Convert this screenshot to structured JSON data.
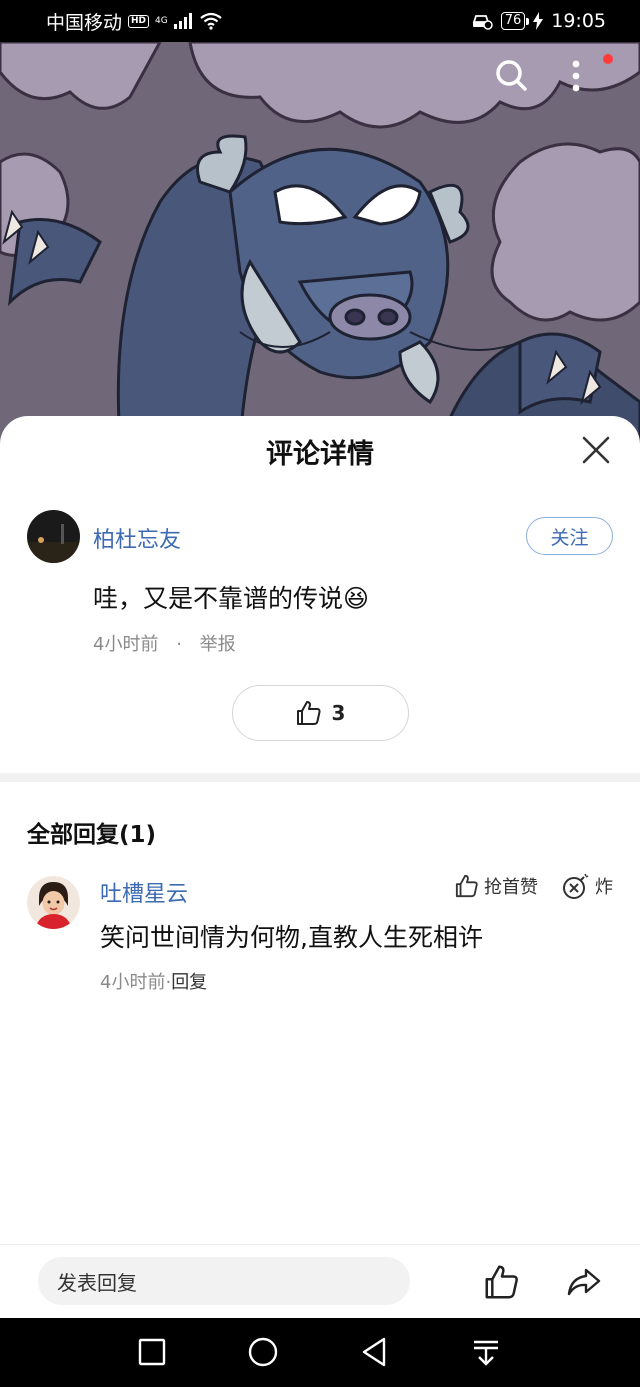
{
  "status_bar": {
    "carrier": "中国移动",
    "hd_badge": "HD",
    "network": "4G",
    "battery": "76",
    "time": "19:05"
  },
  "hero": {
    "icons": [
      "search-icon",
      "more-vertical-icon"
    ],
    "notification_dot_color": "#ff3b3b"
  },
  "sheet": {
    "title": "评论详情",
    "comment": {
      "author": "柏杜忘友",
      "follow_label": "关注",
      "text": "哇，又是不靠谱的传说😆",
      "time": "4小时前",
      "separator": "·",
      "report_label": "举报",
      "like_count": "3"
    },
    "replies_header": "全部回复(1)",
    "replies": [
      {
        "author": "吐槽星云",
        "text": "笑问世间情为何物,直教人生死相许",
        "time": "4小时前",
        "separator": "·",
        "reply_label": "回复",
        "first_like_label": "抢首赞",
        "bomb_label": "炸"
      }
    ]
  },
  "bottom_bar": {
    "reply_placeholder": "发表回复"
  },
  "colors": {
    "accent_blue": "#3d6bb3",
    "follow_border": "#8cb0e0"
  }
}
